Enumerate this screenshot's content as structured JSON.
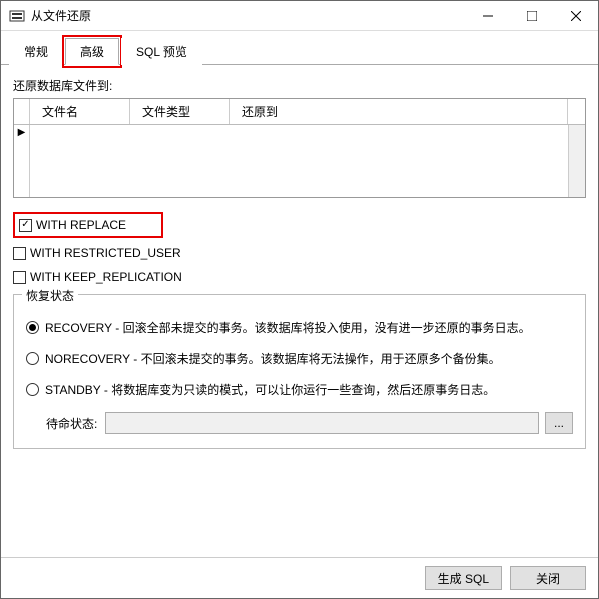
{
  "window": {
    "title": "从文件还原"
  },
  "tabs": {
    "general": "常规",
    "advanced": "高级",
    "sql_preview": "SQL 预览"
  },
  "restore_section": {
    "label": "还原数据库文件到:",
    "columns": {
      "filename": "文件名",
      "filetype": "文件类型",
      "restore_to": "还原到"
    }
  },
  "options": {
    "with_replace": "WITH REPLACE",
    "with_restricted_user": "WITH RESTRICTED_USER",
    "with_keep_replication": "WITH KEEP_REPLICATION"
  },
  "recovery_state": {
    "legend": "恢复状态",
    "recovery": "RECOVERY - 回滚全部未提交的事务。该数据库将投入使用，没有进一步还原的事务日志。",
    "norecovery": "NORECOVERY - 不回滚未提交的事务。该数据库将无法操作，用于还原多个备份集。",
    "standby": "STANDBY - 将数据库变为只读的模式，可以让你运行一些查询，然后还原事务日志。",
    "standby_label": "待命状态:",
    "browse": "..."
  },
  "footer": {
    "generate_sql": "生成 SQL",
    "close": "关闭"
  }
}
